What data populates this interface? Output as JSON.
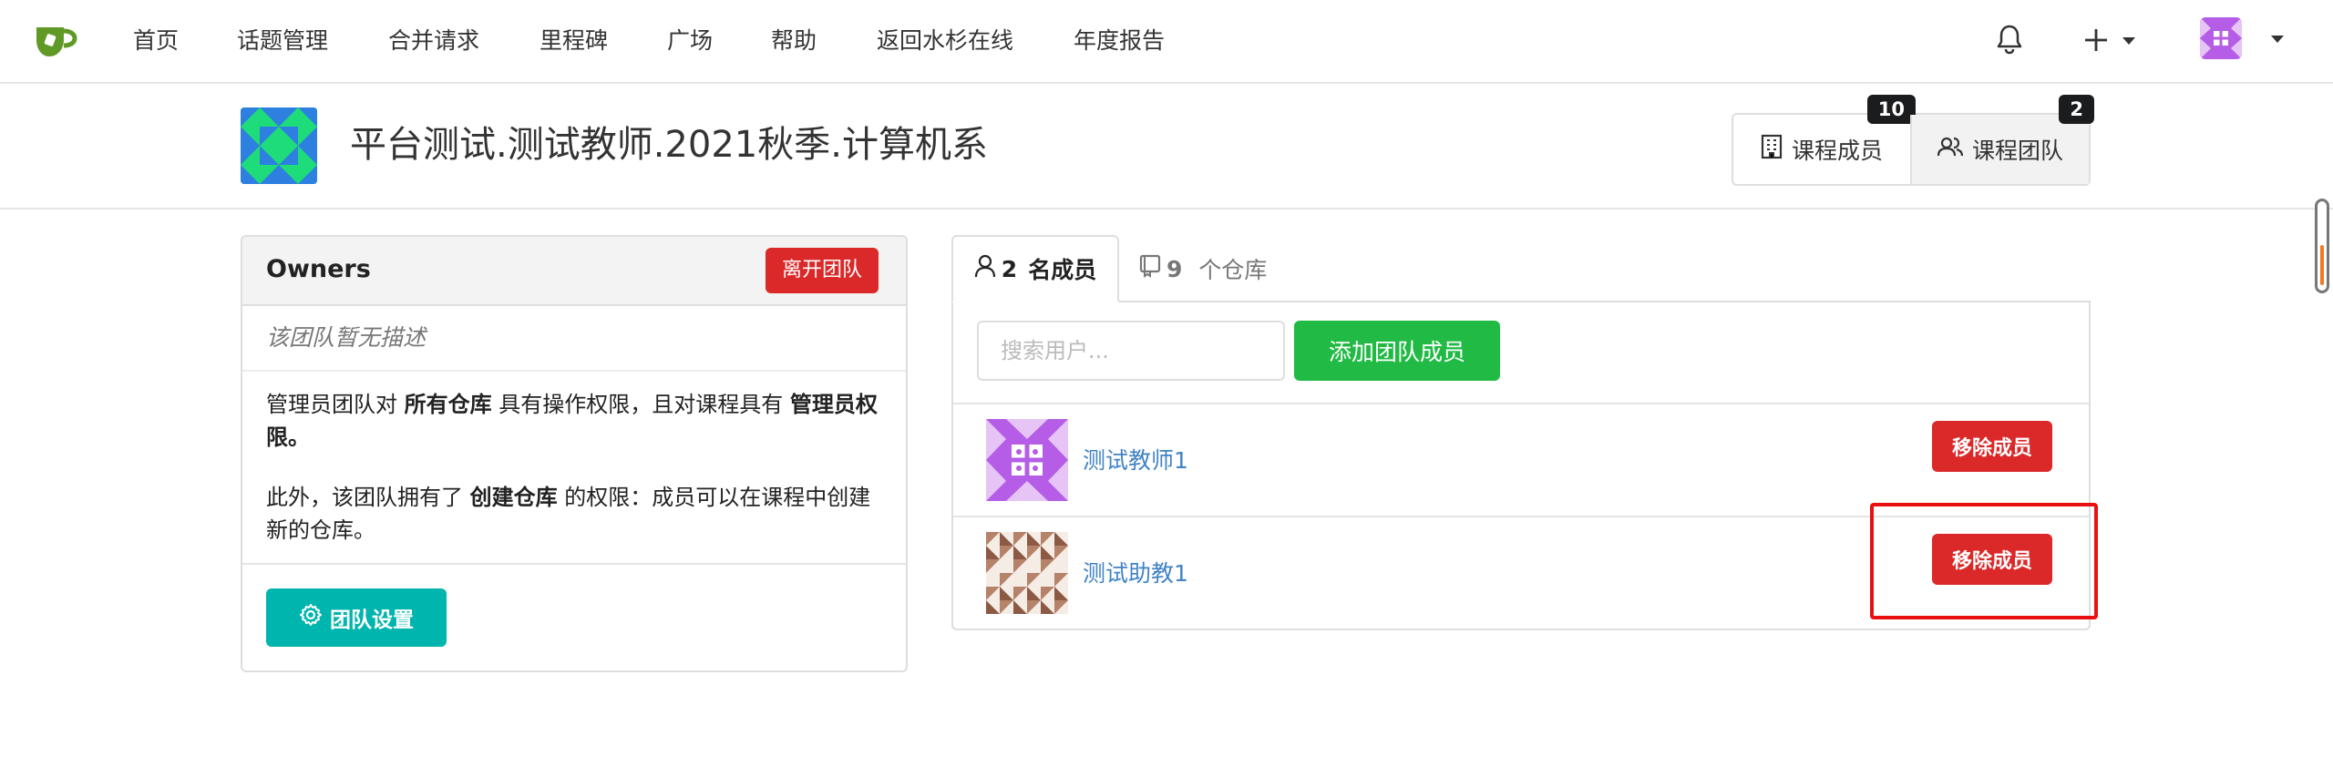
{
  "nav": {
    "items": [
      "首页",
      "话题管理",
      "合并请求",
      "里程碑",
      "广场",
      "帮助",
      "返回水杉在线",
      "年度报告"
    ]
  },
  "org": {
    "title": "平台测试.测试教师.2021秋季.计算机系",
    "tabs": [
      {
        "label": "课程成员",
        "count": "10",
        "icon": "building-icon"
      },
      {
        "label": "课程团队",
        "count": "2",
        "icon": "people-icon"
      }
    ]
  },
  "team": {
    "name": "Owners",
    "leave_label": "离开团队",
    "description": "该团队暂无描述",
    "perm1": {
      "t1": "管理员团队对 ",
      "b1": "所有仓库",
      "t2": " 具有操作权限，且对课程具有 ",
      "b2": "管理员权限",
      "t3": "。"
    },
    "perm2": {
      "t1": "此外，该团队拥有了 ",
      "b1": "创建仓库",
      "t2": " 的权限：成员可以在课程中创建新的仓库。"
    },
    "settings_label": "团队设置"
  },
  "members_panel": {
    "tab_members_count": "2",
    "tab_members_label": "名成员",
    "tab_repos_count": "9",
    "tab_repos_label": "个仓库",
    "search_placeholder": "搜索用户...",
    "add_label": "添加团队成员",
    "remove_label": "移除成员",
    "members": [
      {
        "name": "测试教师1"
      },
      {
        "name": "测试助教1"
      }
    ]
  },
  "colors": {
    "remove": "#db2828",
    "add": "#21ba45",
    "settings": "#00b5ad",
    "link": "#4183c4",
    "highlight": "#e81010"
  }
}
